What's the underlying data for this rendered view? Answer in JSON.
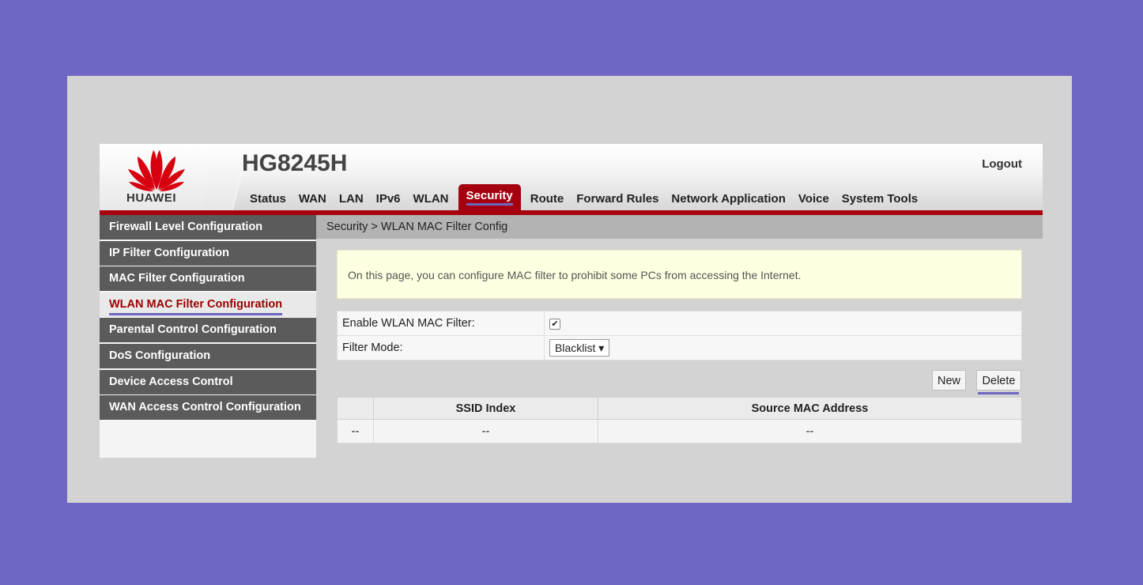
{
  "header": {
    "brand": "HUAWEI",
    "model": "HG8245H",
    "logout": "Logout"
  },
  "nav": [
    "Status",
    "WAN",
    "LAN",
    "IPv6",
    "WLAN",
    "Security",
    "Route",
    "Forward Rules",
    "Network Application",
    "Voice",
    "System Tools"
  ],
  "nav_active": "Security",
  "sidebar": {
    "items": [
      {
        "label": "Firewall Level Configuration"
      },
      {
        "label": "IP Filter Configuration"
      },
      {
        "label": "MAC Filter Configuration"
      },
      {
        "label": "WLAN MAC Filter Configuration"
      },
      {
        "label": "Parental Control Configuration"
      },
      {
        "label": "DoS Configuration"
      },
      {
        "label": "Device Access Control"
      },
      {
        "label": "WAN Access Control Configuration"
      }
    ],
    "active_index": 3
  },
  "main": {
    "breadcrumb": "Security > WLAN MAC Filter Config",
    "notice": "On this page, you can configure MAC filter to prohibit some PCs from accessing the Internet.",
    "enable_label": "Enable WLAN MAC Filter:",
    "enable_checked": "✔",
    "mode_label": "Filter Mode:",
    "mode_value": "Blacklist",
    "new_label": "New",
    "delete_label": "Delete",
    "table": {
      "columns": [
        "",
        "SSID Index",
        "Source MAC Address"
      ],
      "rows": [
        [
          "--",
          "--",
          "--"
        ]
      ]
    }
  },
  "colors": {
    "background": "#6e67c3",
    "brand_red": "#a5000f",
    "highlight": "#6e67c3"
  }
}
